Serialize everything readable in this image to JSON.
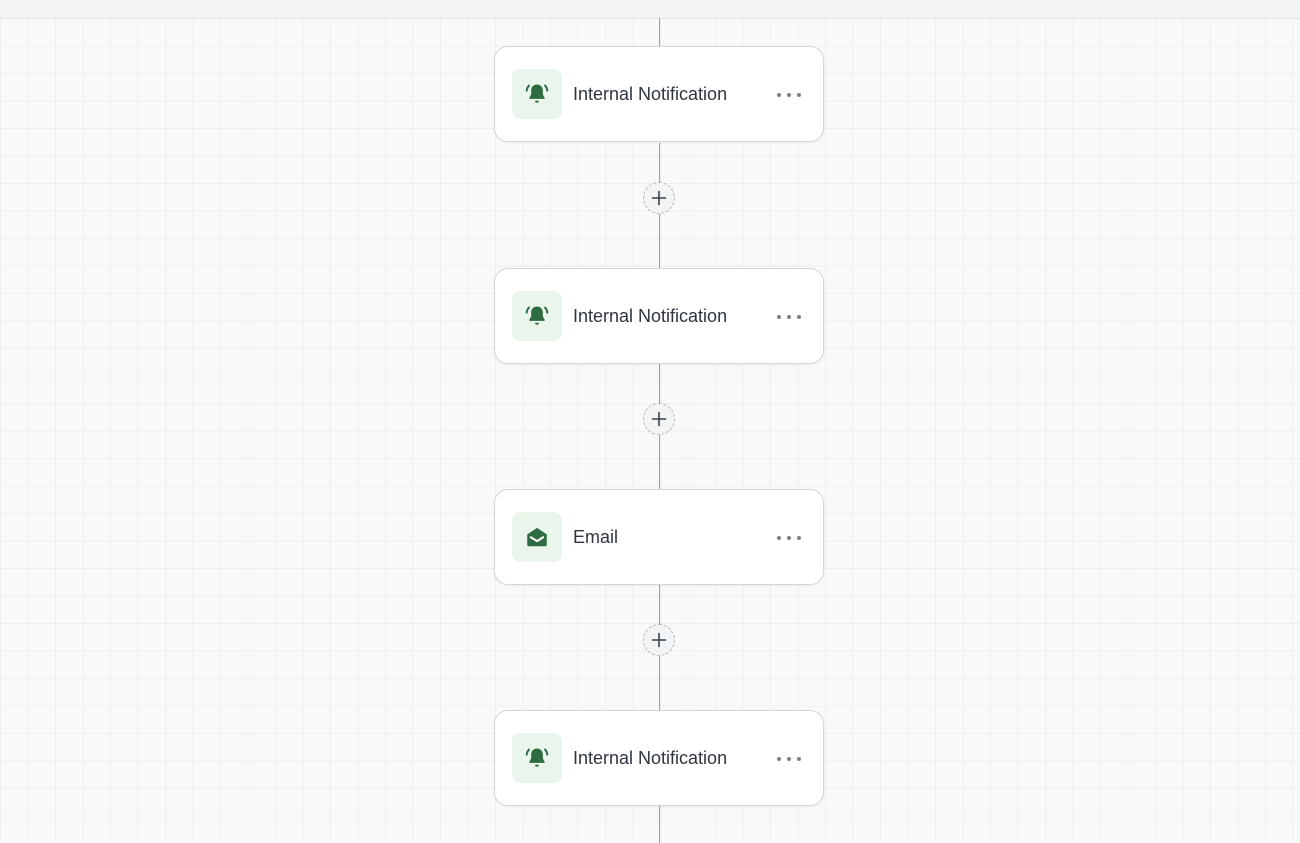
{
  "workflow": {
    "nodes": [
      {
        "label": "Internal Notification",
        "icon": "bell-ringing-icon"
      },
      {
        "label": "Internal Notification",
        "icon": "bell-ringing-icon"
      },
      {
        "label": "Email",
        "icon": "envelope-open-icon"
      },
      {
        "label": "Internal Notification",
        "icon": "bell-ringing-icon"
      }
    ],
    "add_step_icon": "plus-icon",
    "node_menu_icon": "more-horizontal-icon"
  },
  "colors": {
    "icon_green": "#2e6b41",
    "icon_bg": "#eaf6ec",
    "connector": "#9aa0a6",
    "label_text": "#2f3540",
    "canvas_bg": "#f8f9fa"
  }
}
